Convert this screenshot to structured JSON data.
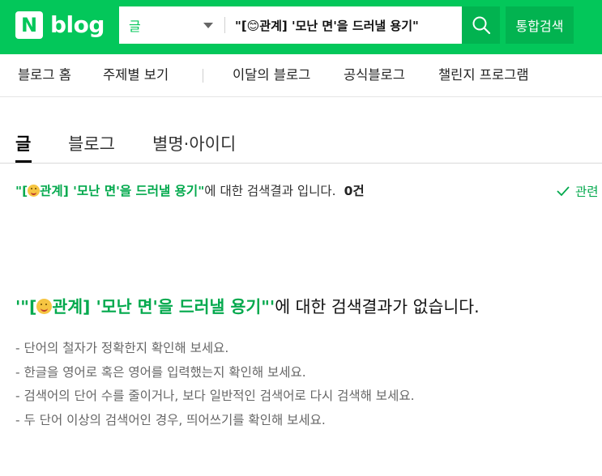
{
  "header": {
    "logo_n": "N",
    "logo_text": "blog",
    "search_scope": "글",
    "search_query": "\"[😊관계] '모난 면'을 드러낼 용기\"",
    "total_search_label": "통합검색",
    "brand_color": "#03c75a"
  },
  "nav": {
    "items": [
      {
        "label": "블로그 홈"
      },
      {
        "label": "주제별 보기"
      },
      {
        "label": "이달의 블로그"
      },
      {
        "label": "공식블로그"
      },
      {
        "label": "챌린지 프로그램"
      }
    ]
  },
  "tabs": [
    {
      "label": "글",
      "active": true
    },
    {
      "label": "블로그",
      "active": false
    },
    {
      "label": "별명·아이디",
      "active": false
    }
  ],
  "result": {
    "query_prefix": "\"[",
    "query_suffix": "관계] '모난 면'을 드러낼 용기\"",
    "suffix_text": "에 대한 검색결과 입니다.",
    "count": "0건",
    "related_label": "관련"
  },
  "no_result": {
    "query_prefix": "'\"[",
    "query_suffix": "관계] '모난 면'을 드러낼 용기\"'",
    "message": "에 대한 검색결과가 없습니다."
  },
  "tips": [
    "- 단어의 철자가 정확한지 확인해 보세요.",
    "- 한글을 영어로 혹은 영어를 입력했는지 확인해 보세요.",
    "- 검색어의 단어 수를 줄이거나, 보다 일반적인 검색어로 다시 검색해 보세요.",
    "- 두 단어 이상의 검색어인 경우, 띄어쓰기를 확인해 보세요."
  ]
}
